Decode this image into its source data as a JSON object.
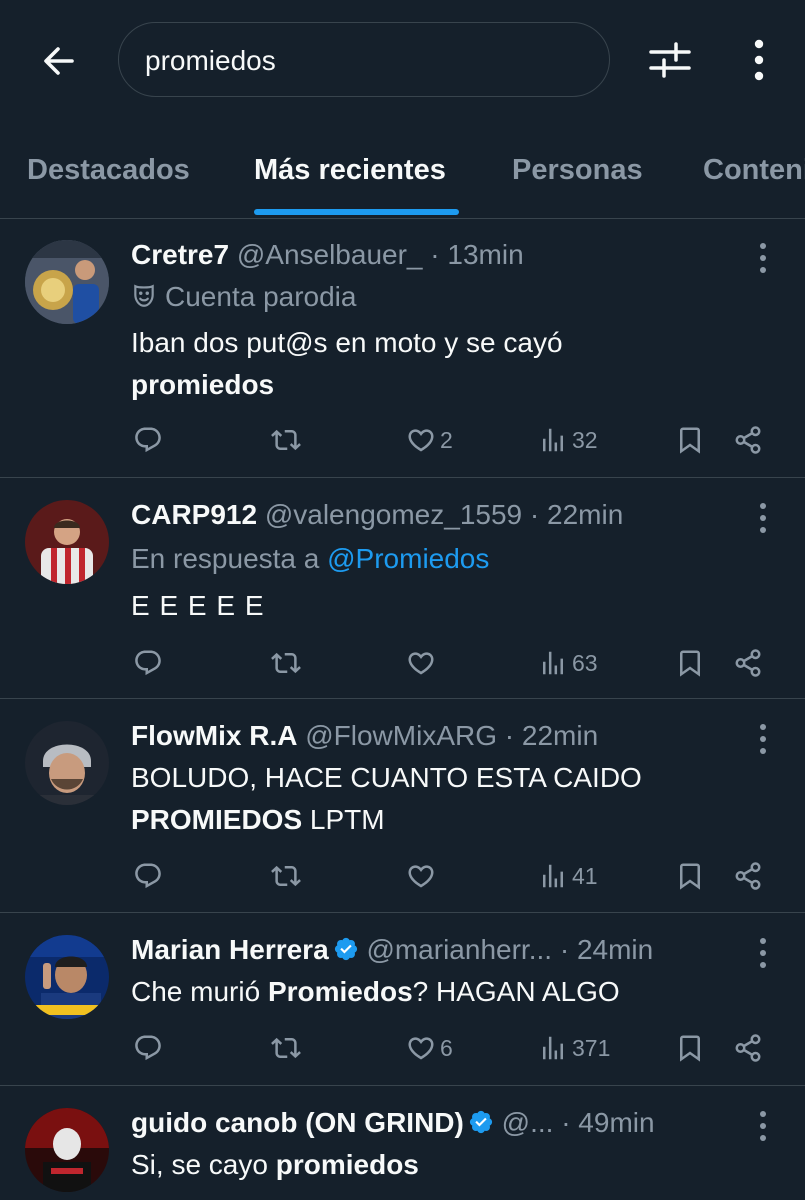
{
  "search": {
    "query": "promiedos"
  },
  "tabs": [
    {
      "label": "Destacados"
    },
    {
      "label": "Más recientes"
    },
    {
      "label": "Personas"
    },
    {
      "label": "Contenido"
    }
  ],
  "colors": {
    "background": "#15202b",
    "accent": "#1d9bf0",
    "muted": "#8b98a5",
    "divider": "#38444d",
    "text": "#f7f9f9"
  },
  "posts": [
    {
      "name": "Cretre7",
      "handle": "@Anselbauer_",
      "dot": "·",
      "time": "13min",
      "parody_label": "Cuenta parodia",
      "text_plain": "Iban dos put@s en moto y se cayó",
      "text_bold": "promiedos",
      "replies": "",
      "reposts": "",
      "likes": "2",
      "views": "32"
    },
    {
      "name": "CARP912",
      "handle": "@valengomez_1559",
      "dot": "·",
      "time": "22min",
      "reply_prefix": "En respuesta a",
      "reply_to": "@Promiedos",
      "text_plain": "E E E E E",
      "likes": "",
      "views": "63"
    },
    {
      "name": "FlowMix R.A",
      "handle": "@FlowMixARG",
      "dot": "·",
      "time": "22min",
      "text_line1": "BOLUDO, HACE CUANTO ESTA CAIDO",
      "text_bold": "PROMIEDOS",
      "text_after": "LPTM",
      "likes": "",
      "views": "41"
    },
    {
      "name": "Marian Herrera",
      "handle": "@marianherr...",
      "dot": "·",
      "time": "24min",
      "verified": true,
      "text_before": "Che murió",
      "text_bold": "Promiedos",
      "text_after": "? HAGAN ALGO",
      "likes": "6",
      "views": "371"
    },
    {
      "name": "guido canob (ON GRIND)",
      "handle": "@...",
      "dot": "·",
      "time": "49min",
      "verified": true,
      "text_before": "Si, se cayo",
      "text_bold": "promiedos"
    }
  ]
}
